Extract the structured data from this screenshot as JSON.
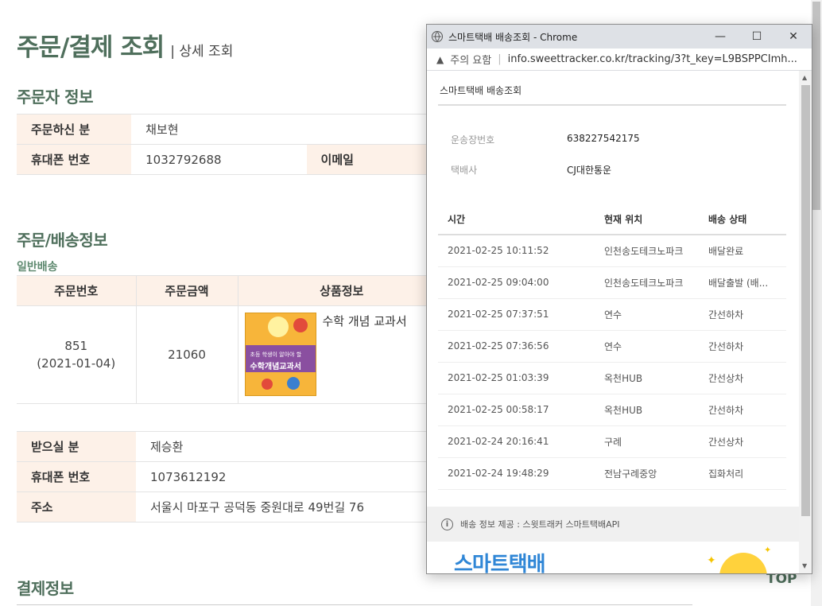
{
  "page": {
    "title": "주문/결제 조회",
    "title_sub": "| 상세 조회",
    "orderer_section": "주문자 정보",
    "orderer": {
      "name_label": "주문하신 분",
      "name_value": "채보현",
      "phone_label": "휴대폰 번호",
      "phone_value": "1032792688",
      "email_label": "이메일"
    },
    "shipping_section": "주문/배송정보",
    "shipping_type": "일반배송",
    "order_table": {
      "headers": [
        "주문번호",
        "주문금액",
        "상품정보"
      ],
      "order_no": "851",
      "order_date": "(2021-01-04)",
      "amount": "21060",
      "product_name": "수학 개념 교과서"
    },
    "receiver": {
      "name_label": "받으실 분",
      "name_value": "제승환",
      "phone_label": "휴대폰 번호",
      "phone_value": "1073612192",
      "address_label": "주소",
      "address_value": "서울시 마포구 공덕동 중원대로 49번길 76"
    },
    "payment_section": "결제정보",
    "top_button": "TOP"
  },
  "popup": {
    "window_title": "스마트택배 배송조회 - Chrome",
    "minimize": "—",
    "maximize": "☐",
    "close": "✕",
    "warning": "주의 요함",
    "url": "info.sweettracker.co.kr/tracking/3?t_key=L9BSPPCImh...",
    "heading": "스마트택배 배송조회",
    "invoice_label": "운송장번호",
    "invoice_value": "638227542175",
    "carrier_label": "택배사",
    "carrier_value": "CJ대한통운",
    "columns": [
      "시간",
      "현재 위치",
      "배송 상태"
    ],
    "rows": [
      {
        "time": "2021-02-25 10:11:52",
        "location": "인천송도테크노파크",
        "status": "배달완료"
      },
      {
        "time": "2021-02-25 09:04:00",
        "location": "인천송도테크노파크",
        "status": "배달출발 (배..."
      },
      {
        "time": "2021-02-25 07:37:51",
        "location": "연수",
        "status": "간선하차"
      },
      {
        "time": "2021-02-25 07:36:56",
        "location": "연수",
        "status": "간선하차"
      },
      {
        "time": "2021-02-25 01:03:39",
        "location": "옥천HUB",
        "status": "간선상차"
      },
      {
        "time": "2021-02-25 00:58:17",
        "location": "옥천HUB",
        "status": "간선하차"
      },
      {
        "time": "2021-02-24 20:16:41",
        "location": "구례",
        "status": "간선상차"
      },
      {
        "time": "2021-02-24 19:48:29",
        "location": "전남구례중앙",
        "status": "집화처리"
      }
    ],
    "provider_text": "배송 정보 제공 : 스윗트래커 스마트택배API",
    "banner_brand": "스마트택배"
  }
}
